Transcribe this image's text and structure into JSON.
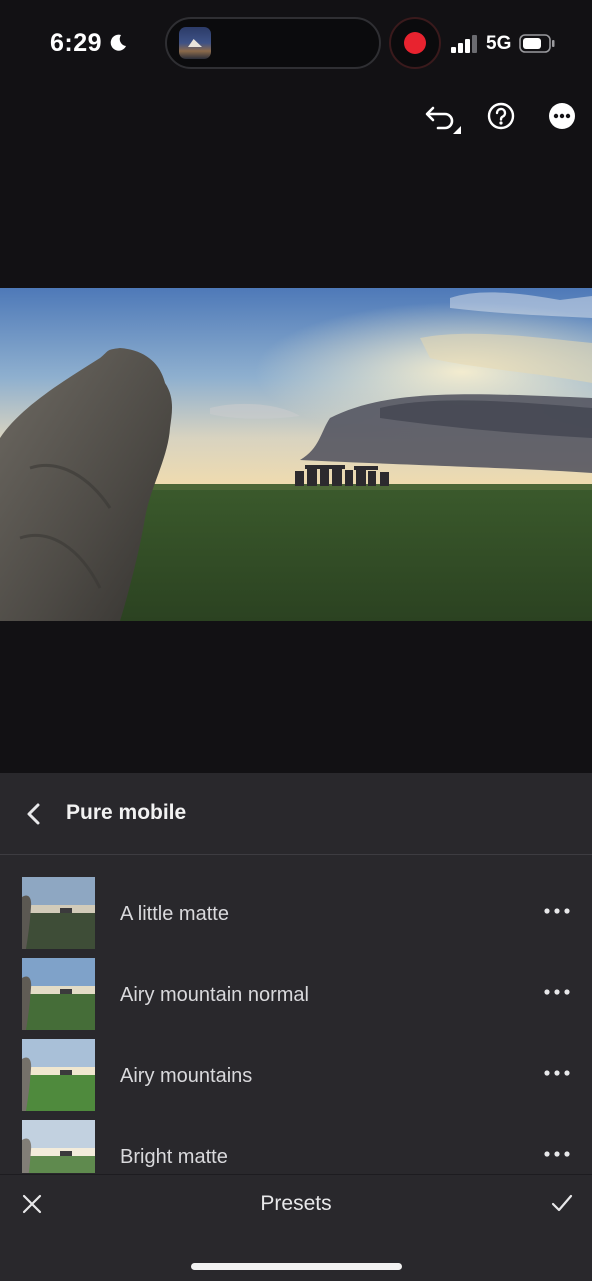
{
  "status_bar": {
    "time": "6:29",
    "network": "5G",
    "recording_color": "#e8232f"
  },
  "toolbar": {
    "icons": [
      "undo-icon",
      "help-icon",
      "more-icon"
    ]
  },
  "photo": {
    "subject": "Stonehenge landscape"
  },
  "panel": {
    "title": "Pure mobile",
    "presets": [
      {
        "label": "A little matte"
      },
      {
        "label": "Airy mountain normal"
      },
      {
        "label": "Airy mountains"
      },
      {
        "label": "Bright matte"
      }
    ]
  },
  "bottom_bar": {
    "title": "Presets"
  }
}
